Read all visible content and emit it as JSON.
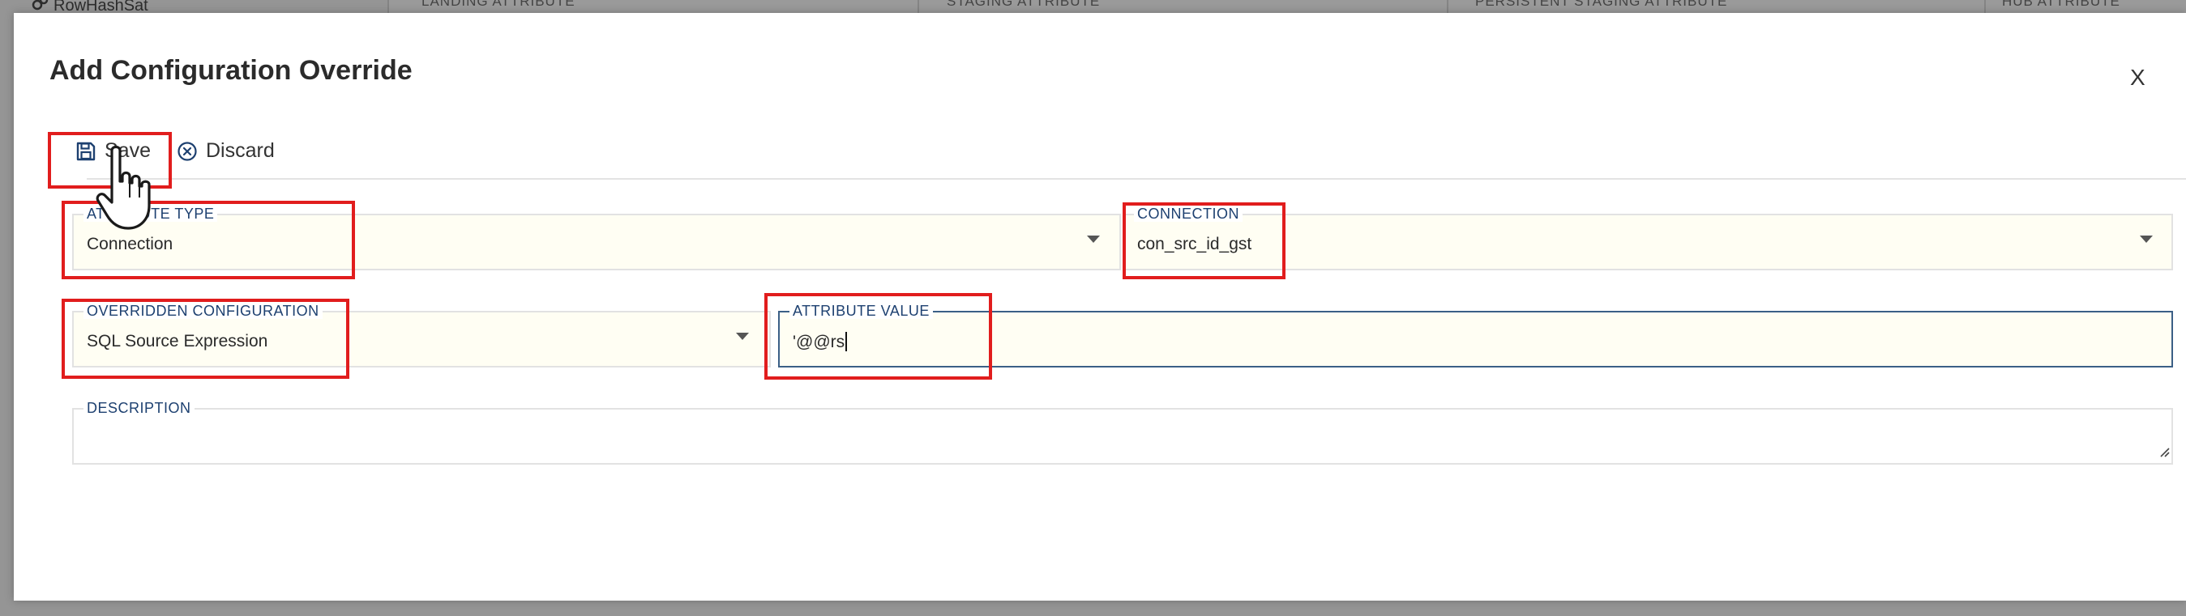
{
  "background": {
    "sidebar_item": "RowHashSat",
    "column_headers": [
      "LANDING ATTRIBUTE",
      "STAGING ATTRIBUTE",
      "PERSISTENT STAGING ATTRIBUTE",
      "HUB ATTRIBUTE"
    ]
  },
  "modal": {
    "title": "Add Configuration Override",
    "close_label": "X"
  },
  "toolbar": {
    "save_label": "Save",
    "discard_label": "Discard"
  },
  "form": {
    "attribute_type": {
      "label": "ATTRIBUTE TYPE",
      "value": "Connection"
    },
    "connection": {
      "label": "CONNECTION",
      "value": "con_src_id_gst"
    },
    "overridden_configuration": {
      "label": "OVERRIDDEN CONFIGURATION",
      "value": "SQL Source Expression"
    },
    "attribute_value": {
      "label": "ATTRIBUTE VALUE",
      "value": "'@@rs"
    },
    "description": {
      "label": "DESCRIPTION",
      "value": ""
    }
  },
  "colors": {
    "highlight": "#e11d1d",
    "label_text": "#1d4070",
    "field_background": "#fffef3",
    "active_border": "#3b5f86"
  }
}
